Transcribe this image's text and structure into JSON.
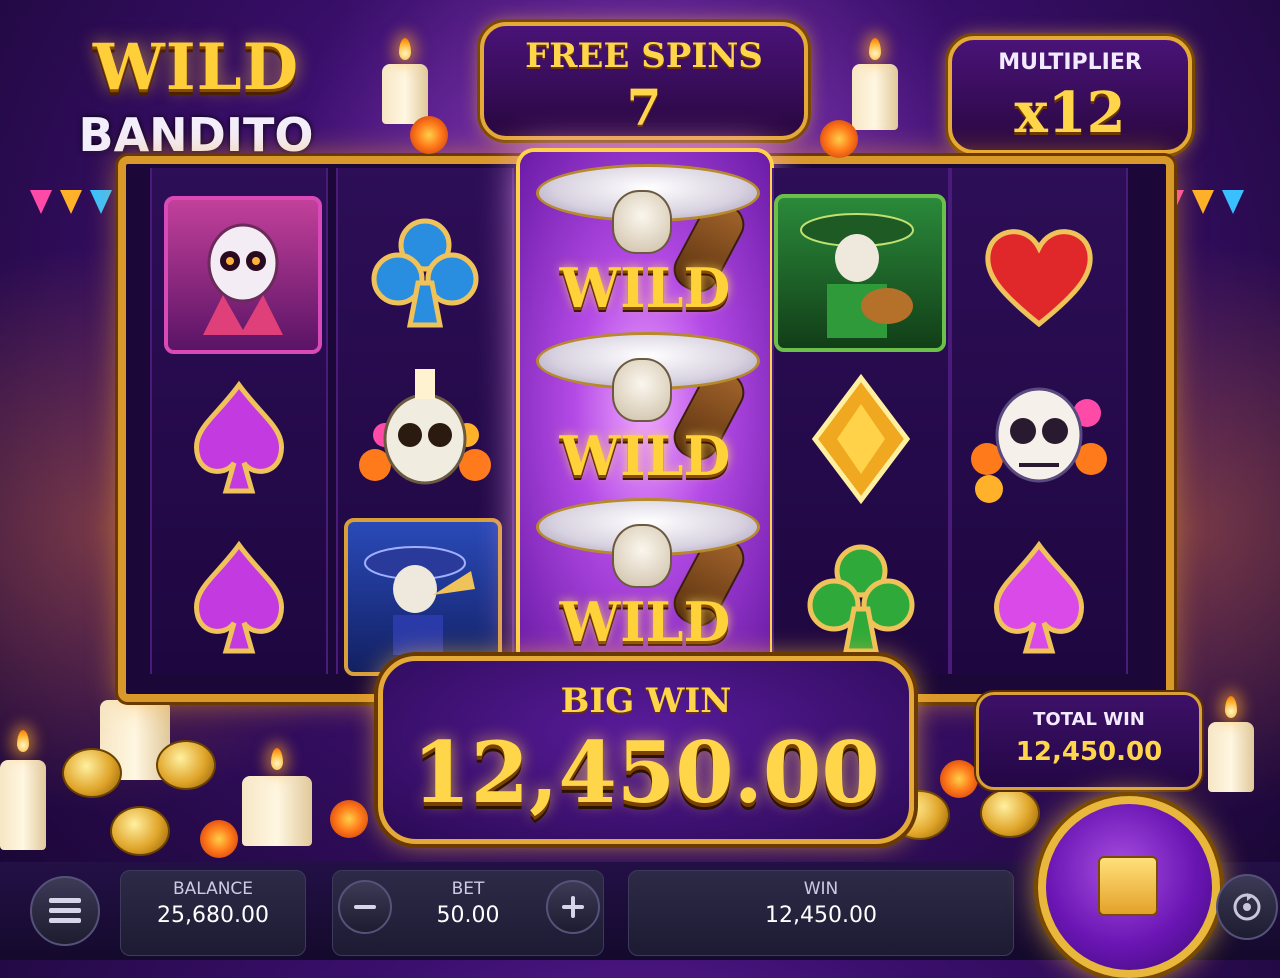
{
  "logo": {
    "line1": "WILD",
    "line2": "BANDITO"
  },
  "free_spins": {
    "label": "FREE SPINS",
    "count": "7"
  },
  "multiplier": {
    "label": "MULTIPLIER",
    "value": "x12"
  },
  "reels": {
    "reel1": [
      "catrina-fan-symbol",
      "purple-spade-symbol",
      "purple-spade-symbol"
    ],
    "reel2": [
      "blue-club-symbol",
      "sugar-skull-candle-symbol",
      "trumpet-mariachi-symbol"
    ],
    "reel3": {
      "symbol": "mariachi-guitar-wild-symbol",
      "wild_label": "WILD",
      "count": 3
    },
    "reel4": [
      "green-mariachi-guitar-symbol",
      "gold-diamond-symbol",
      "green-club-symbol"
    ],
    "reel5": [
      "red-heart-symbol",
      "sugar-skull-flowers-symbol",
      "purple-spade-symbol"
    ]
  },
  "big_win": {
    "label": "BIG WIN",
    "amount": "12,450.00"
  },
  "total_win": {
    "label": "TOTAL WIN",
    "amount": "12,450.00"
  },
  "bottom_bar": {
    "balance_label": "BALANCE",
    "balance_value": "25,680.00",
    "bet_label": "BET",
    "bet_value": "50.00",
    "win_label": "WIN",
    "win_value": "12,450.00",
    "menu_icon": "menu-icon",
    "minus_icon": "minus-icon",
    "plus_icon": "plus-icon",
    "spin_stop_icon": "stop-icon",
    "autoplay_icon": "autoplay-icon"
  },
  "colors": {
    "gold": "#ffd64a",
    "frame_gold": "#e4a936",
    "purple_bg": "#3b0f6e",
    "spin_purple": "#6a15b4"
  }
}
